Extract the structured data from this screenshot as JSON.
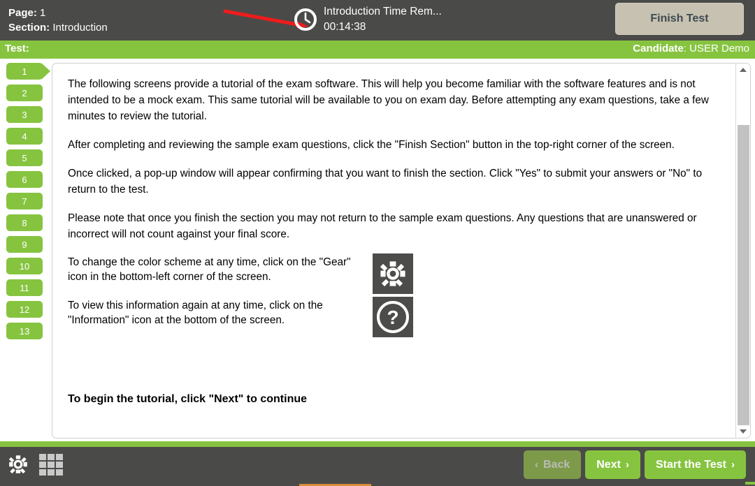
{
  "header": {
    "page_label": "Page:",
    "page_value": "1",
    "section_label": "Section:",
    "section_value": "Introduction",
    "clock_icon": "clock-icon",
    "timer_label": "Introduction Time Rem...",
    "timer_value": "00:14:38",
    "finish_test_label": "Finish Test",
    "annotation_arrow": "red-arrow-pointing-to-timer"
  },
  "infobar": {
    "test_label": "Test:",
    "test_value": "",
    "candidate_label": "Candidate",
    "candidate_value": "USER Demo"
  },
  "sidebar": {
    "items": [
      {
        "label": "1",
        "current": true
      },
      {
        "label": "2",
        "current": false
      },
      {
        "label": "3",
        "current": false
      },
      {
        "label": "4",
        "current": false
      },
      {
        "label": "5",
        "current": false
      },
      {
        "label": "6",
        "current": false
      },
      {
        "label": "7",
        "current": false
      },
      {
        "label": "8",
        "current": false
      },
      {
        "label": "9",
        "current": false
      },
      {
        "label": "10",
        "current": false
      },
      {
        "label": "11",
        "current": false
      },
      {
        "label": "12",
        "current": false
      },
      {
        "label": "13",
        "current": false
      }
    ]
  },
  "content": {
    "paragraph_1": "The following screens provide a tutorial of the exam software. This will help you become familiar with the software features and is not intended to be a mock exam. This same tutorial will be available to you on exam day. Before attempting any exam questions, take a few minutes to review the tutorial.",
    "paragraph_2": "After completing and reviewing the sample exam questions, click the \"Finish Section\" button in the top-right corner of the screen.",
    "paragraph_3": "Once clicked, a pop-up window will appear confirming that you want to finish the section. Click \"Yes\" to submit your answers or \"No\" to return to the test.",
    "paragraph_4": "Please note that once you finish the section you may not return to the sample exam questions. Any questions that are unanswered or incorrect will not count against your final score.",
    "gear_text": "To change the color scheme at any time, click on the \"Gear\" icon in the bottom-left corner of the screen.",
    "gear_icon": "gear-icon",
    "info_text": "To view this information again at any time, click on the \"Information\" icon at the bottom of the screen.",
    "info_icon": "question-mark-icon",
    "closing_text": "To begin the tutorial, click \"Next\" to continue"
  },
  "scrollbar": {
    "up_icon": "scroll-up-arrow-icon",
    "down_icon": "scroll-down-arrow-icon"
  },
  "footer": {
    "settings_icon": "gear-icon",
    "grid_icon": "grid-menu-icon",
    "back_label": "Back",
    "back_chevron": "‹",
    "next_label": "Next",
    "next_chevron": "›",
    "start_label": "Start the Test",
    "start_chevron": "›"
  },
  "colors": {
    "green": "#86c440",
    "dark": "#4a4a48",
    "muted_green": "#7d9a4b",
    "beige": "#c6c1b0",
    "annotation_red": "#ee1c1c"
  }
}
